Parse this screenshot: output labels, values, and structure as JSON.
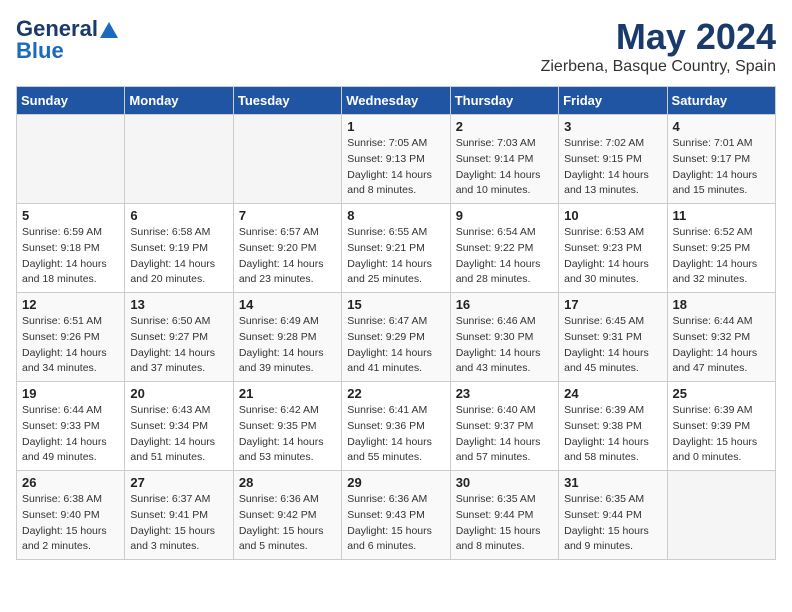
{
  "header": {
    "logo_line1": "General",
    "logo_line2": "Blue",
    "title": "May 2024",
    "subtitle": "Zierbena, Basque Country, Spain"
  },
  "calendar": {
    "weekdays": [
      "Sunday",
      "Monday",
      "Tuesday",
      "Wednesday",
      "Thursday",
      "Friday",
      "Saturday"
    ],
    "weeks": [
      [
        {
          "day": "",
          "info": ""
        },
        {
          "day": "",
          "info": ""
        },
        {
          "day": "",
          "info": ""
        },
        {
          "day": "1",
          "info": "Sunrise: 7:05 AM\nSunset: 9:13 PM\nDaylight: 14 hours\nand 8 minutes."
        },
        {
          "day": "2",
          "info": "Sunrise: 7:03 AM\nSunset: 9:14 PM\nDaylight: 14 hours\nand 10 minutes."
        },
        {
          "day": "3",
          "info": "Sunrise: 7:02 AM\nSunset: 9:15 PM\nDaylight: 14 hours\nand 13 minutes."
        },
        {
          "day": "4",
          "info": "Sunrise: 7:01 AM\nSunset: 9:17 PM\nDaylight: 14 hours\nand 15 minutes."
        }
      ],
      [
        {
          "day": "5",
          "info": "Sunrise: 6:59 AM\nSunset: 9:18 PM\nDaylight: 14 hours\nand 18 minutes."
        },
        {
          "day": "6",
          "info": "Sunrise: 6:58 AM\nSunset: 9:19 PM\nDaylight: 14 hours\nand 20 minutes."
        },
        {
          "day": "7",
          "info": "Sunrise: 6:57 AM\nSunset: 9:20 PM\nDaylight: 14 hours\nand 23 minutes."
        },
        {
          "day": "8",
          "info": "Sunrise: 6:55 AM\nSunset: 9:21 PM\nDaylight: 14 hours\nand 25 minutes."
        },
        {
          "day": "9",
          "info": "Sunrise: 6:54 AM\nSunset: 9:22 PM\nDaylight: 14 hours\nand 28 minutes."
        },
        {
          "day": "10",
          "info": "Sunrise: 6:53 AM\nSunset: 9:23 PM\nDaylight: 14 hours\nand 30 minutes."
        },
        {
          "day": "11",
          "info": "Sunrise: 6:52 AM\nSunset: 9:25 PM\nDaylight: 14 hours\nand 32 minutes."
        }
      ],
      [
        {
          "day": "12",
          "info": "Sunrise: 6:51 AM\nSunset: 9:26 PM\nDaylight: 14 hours\nand 34 minutes."
        },
        {
          "day": "13",
          "info": "Sunrise: 6:50 AM\nSunset: 9:27 PM\nDaylight: 14 hours\nand 37 minutes."
        },
        {
          "day": "14",
          "info": "Sunrise: 6:49 AM\nSunset: 9:28 PM\nDaylight: 14 hours\nand 39 minutes."
        },
        {
          "day": "15",
          "info": "Sunrise: 6:47 AM\nSunset: 9:29 PM\nDaylight: 14 hours\nand 41 minutes."
        },
        {
          "day": "16",
          "info": "Sunrise: 6:46 AM\nSunset: 9:30 PM\nDaylight: 14 hours\nand 43 minutes."
        },
        {
          "day": "17",
          "info": "Sunrise: 6:45 AM\nSunset: 9:31 PM\nDaylight: 14 hours\nand 45 minutes."
        },
        {
          "day": "18",
          "info": "Sunrise: 6:44 AM\nSunset: 9:32 PM\nDaylight: 14 hours\nand 47 minutes."
        }
      ],
      [
        {
          "day": "19",
          "info": "Sunrise: 6:44 AM\nSunset: 9:33 PM\nDaylight: 14 hours\nand 49 minutes."
        },
        {
          "day": "20",
          "info": "Sunrise: 6:43 AM\nSunset: 9:34 PM\nDaylight: 14 hours\nand 51 minutes."
        },
        {
          "day": "21",
          "info": "Sunrise: 6:42 AM\nSunset: 9:35 PM\nDaylight: 14 hours\nand 53 minutes."
        },
        {
          "day": "22",
          "info": "Sunrise: 6:41 AM\nSunset: 9:36 PM\nDaylight: 14 hours\nand 55 minutes."
        },
        {
          "day": "23",
          "info": "Sunrise: 6:40 AM\nSunset: 9:37 PM\nDaylight: 14 hours\nand 57 minutes."
        },
        {
          "day": "24",
          "info": "Sunrise: 6:39 AM\nSunset: 9:38 PM\nDaylight: 14 hours\nand 58 minutes."
        },
        {
          "day": "25",
          "info": "Sunrise: 6:39 AM\nSunset: 9:39 PM\nDaylight: 15 hours\nand 0 minutes."
        }
      ],
      [
        {
          "day": "26",
          "info": "Sunrise: 6:38 AM\nSunset: 9:40 PM\nDaylight: 15 hours\nand 2 minutes."
        },
        {
          "day": "27",
          "info": "Sunrise: 6:37 AM\nSunset: 9:41 PM\nDaylight: 15 hours\nand 3 minutes."
        },
        {
          "day": "28",
          "info": "Sunrise: 6:36 AM\nSunset: 9:42 PM\nDaylight: 15 hours\nand 5 minutes."
        },
        {
          "day": "29",
          "info": "Sunrise: 6:36 AM\nSunset: 9:43 PM\nDaylight: 15 hours\nand 6 minutes."
        },
        {
          "day": "30",
          "info": "Sunrise: 6:35 AM\nSunset: 9:44 PM\nDaylight: 15 hours\nand 8 minutes."
        },
        {
          "day": "31",
          "info": "Sunrise: 6:35 AM\nSunset: 9:44 PM\nDaylight: 15 hours\nand 9 minutes."
        },
        {
          "day": "",
          "info": ""
        }
      ]
    ]
  }
}
